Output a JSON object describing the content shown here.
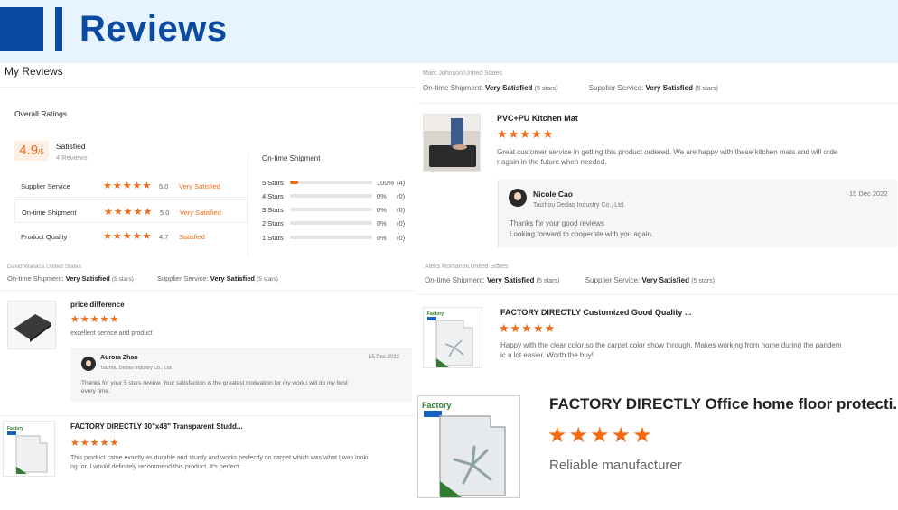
{
  "banner": {
    "title": "Reviews"
  },
  "my_reviews": {
    "title": "My Reviews",
    "overall_label": "Overall Ratings",
    "score": "4.9",
    "score_suffix": "/5",
    "score_text": "Satisfied",
    "reviews_count": "4 Reviews",
    "rows": [
      {
        "label": "Supplier Service",
        "stars": "★★★★★",
        "value": "5.0",
        "verdict": "Very Satisfied"
      },
      {
        "label": "On-time Shipment",
        "stars": "★★★★★",
        "value": "5.0",
        "verdict": "Very Satisfied"
      },
      {
        "label": "Product Quality",
        "stars": "★★★★★",
        "value": "4.7",
        "verdict": "Satisfied"
      }
    ],
    "shipment_title": "On-time Shipment",
    "distribution": [
      {
        "label": "5 Stars",
        "fill": 0.1,
        "pct": "100%",
        "count": "(4)"
      },
      {
        "label": "4 Stars",
        "fill": 0,
        "pct": "0%",
        "count": "(0)"
      },
      {
        "label": "3 Stars",
        "fill": 0,
        "pct": "0%",
        "count": "(0)"
      },
      {
        "label": "2 Stars",
        "fill": 0,
        "pct": "0%",
        "count": "(0)"
      },
      {
        "label": "1 Stars",
        "fill": 0,
        "pct": "0%",
        "count": "(0)"
      }
    ]
  },
  "review_marc": {
    "name": "Marc Johnson,United States",
    "shipment_label": "On-time Shipment:",
    "shipment_value": "Very Satisfied",
    "shipment_stars": "(5 stars)",
    "service_label": "Supplier Service:",
    "service_value": "Very Satisfied",
    "service_stars": "(5 stars)",
    "product_title": "PVC+PU Kitchen Mat",
    "stars": "★★★★★",
    "text_line1": "Great customer service in getting this product ordered. We are happy with these kitchen mats and will orde",
    "text_line2": "r again in the future when needed.",
    "reply": {
      "name": "Nicole Cao",
      "company": "Taizhou Dedao Industry Co., Ltd.",
      "date": "15 Dec 2022",
      "line1": "Thanks for your good reviews",
      "line2": "Looking forward to cooperate with you again."
    }
  },
  "review_david": {
    "name": "David Wallace,United States",
    "shipment_label": "On-time Shipment:",
    "shipment_value": "Very Satisfied",
    "shipment_stars": "(5 stars)",
    "service_label": "Supplier Service:",
    "service_value": "Very Satisfied",
    "service_stars": "(5 stars)",
    "product_title": "price difference",
    "stars": "★★★★★",
    "text": "excellent service and product",
    "reply": {
      "name": "Aurora Zhao",
      "company": "Taizhou Dedao Industry Co., Ltd.",
      "date": "15 Dec 2022",
      "line1": "Thanks for your 5 stars review. Your satisfaction is the greatest motivation for my work,i will do my best",
      "line2": "every time."
    },
    "second_title": "FACTORY DIRECTLY 30\"x48\" Transparent Studd...",
    "second_stars": "★★★★★",
    "second_line1": "This product came exactly as durable and sturdy and works perfectly on carpet which was what I was looki",
    "second_line2": "ng for. I would definitely recommend this product. It's perfect."
  },
  "review_aleks": {
    "name": "Aleks Romanov,United States",
    "shipment_label": "On-time Shipment:",
    "shipment_value": "Very Satisfied",
    "shipment_stars": "(5 stars)",
    "service_label": "Supplier Service:",
    "service_value": "Very Satisfied",
    "service_stars": "(5 stars)",
    "product_title": "FACTORY DIRECTLY Customized Good Quality ...",
    "stars": "★★★★★",
    "text_line1": "Happy with the clear color so the carpet color show through. Makes working from home during the pandem",
    "text_line2": "ic a lot easier. Worth the buy!"
  },
  "zoom": {
    "product_title": "FACTORY DIRECTLY Office home floor protecti...",
    "stars": "★★★★★",
    "text": "Reliable manufacturer",
    "brand": "Factory"
  },
  "colors": {
    "accent": "#f26a13",
    "brand_blue": "#0a4aa0",
    "banner_bg": "#e8f4fd"
  }
}
